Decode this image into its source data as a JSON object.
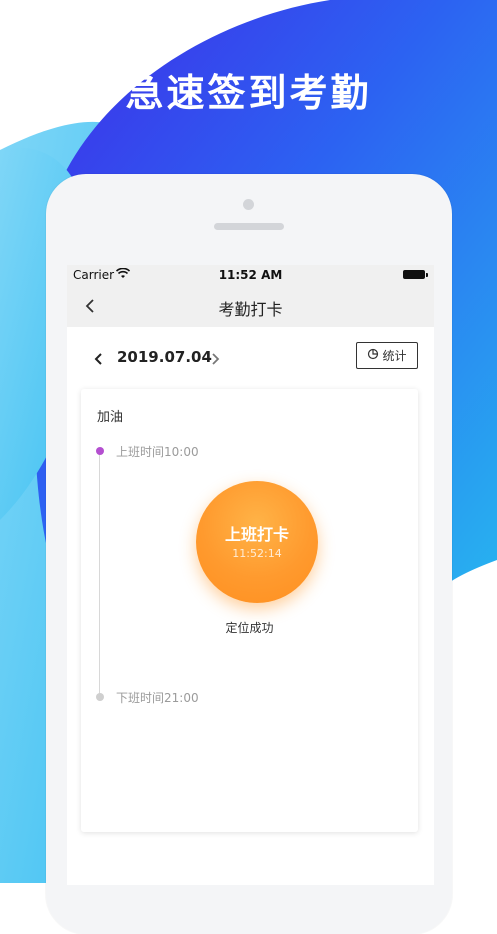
{
  "headline": "急速签到考勤",
  "colors": {
    "accent": "#ff9a2e",
    "brand_blue": "#2b6ef0",
    "timeline_start": "#b44fd0"
  },
  "status_bar": {
    "carrier": "Carrier",
    "time": "11:52 AM"
  },
  "nav": {
    "title": "考勤打卡",
    "back_icon": "chevron-left-icon"
  },
  "date_bar": {
    "date": "2019.07.04",
    "stats_label": "统计",
    "stats_icon": "pie-chart-icon"
  },
  "card": {
    "title": "加油",
    "start_label": "上班时间10:00",
    "end_label": "下班时间21:00",
    "punch_label": "上班打卡",
    "punch_time": "11:52:14",
    "location_status": "定位成功"
  }
}
